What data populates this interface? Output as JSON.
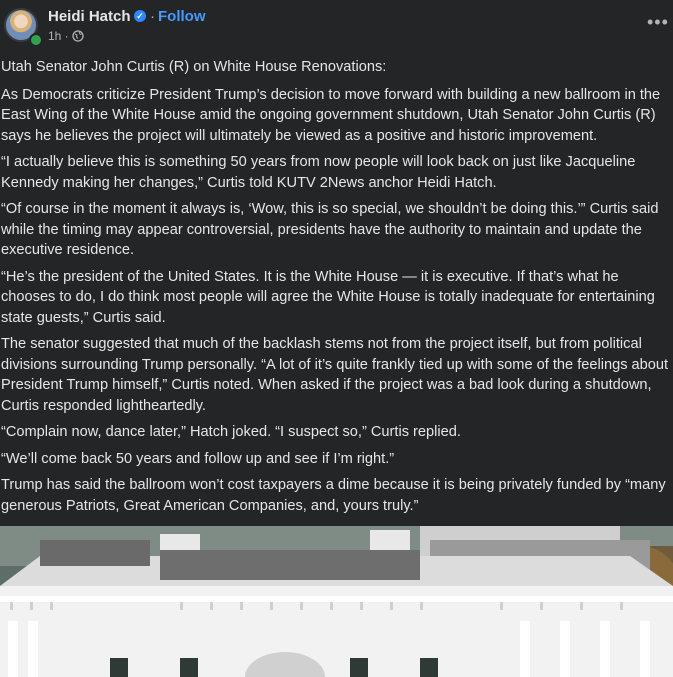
{
  "header": {
    "author_name": "Heidi Hatch",
    "verified_icon": "verified-badge-icon",
    "separator": "·",
    "follow_label": "Follow",
    "timestamp": "1h ·",
    "privacy_icon": "globe-icon",
    "more_icon": "more-options-icon",
    "more_symbol": "•••"
  },
  "post": {
    "paragraphs": [
      "Utah Senator John Curtis (R) on White House Renovations:",
      "As Democrats criticize President Trump’s decision to move forward with building a new ballroom in the East Wing of the White House amid the ongoing government shutdown, Utah Senator John Curtis (R) says he believes the project will ultimately be viewed as a positive and historic improvement.",
      "“I actually believe this is something 50 years from now people will look back on just like Jacqueline Kennedy making her changes,” Curtis told KUTV 2News anchor Heidi Hatch.",
      "“Of course in the moment it always is, ‘Wow, this is so special, we shouldn’t be doing this.’”  Curtis said while the timing may appear controversial, presidents have the authority to maintain and update the executive residence.",
      "“He’s the president of the United States. It is the White House — it is executive. If that’s what he chooses to do, I do think most people will agree the White House is totally inadequate for entertaining state guests,” Curtis said.",
      "The senator suggested that much of the backlash stems not from the project itself, but from political divisions surrounding Trump personally.  “A lot of it’s quite frankly tied up with some of the feelings about President Trump himself,” Curtis noted.  When asked if the project was a bad look during a shutdown, Curtis responded lightheartedly.",
      "“Complain now, dance later,” Hatch joked. “I suspect so,” Curtis replied.",
      "“We’ll come back 50 years and follow up and see if I’m right.”",
      "Trump has said the ballroom won’t cost taxpayers a dime because it is being privately funded by “many generous Patriots, Great American Companies, and, yours truly.”"
    ]
  },
  "photo": {
    "subject": "white-house-aerial-photo"
  }
}
